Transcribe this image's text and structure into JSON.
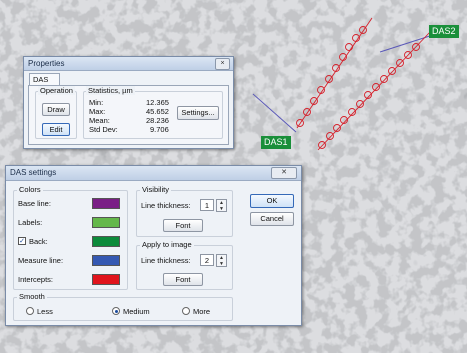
{
  "overlay_tags": [
    "DAS2",
    "DAS1"
  ],
  "properties": {
    "title": "Properties",
    "close_glyph": "×",
    "tab": "DAS",
    "operation": {
      "legend": "Operation",
      "draw": "Draw",
      "edit": "Edit"
    },
    "statistics": {
      "legend": "Statistics, µm",
      "rows": [
        {
          "label": "Min:",
          "value": "12.365"
        },
        {
          "label": "Max:",
          "value": "45.652"
        },
        {
          "label": "Mean:",
          "value": "28.236"
        },
        {
          "label": "Std Dev:",
          "value": "9.706"
        }
      ]
    },
    "settings_button": "Settings..."
  },
  "das_settings": {
    "title": "DAS settings",
    "close_glyph": "✕",
    "colors": {
      "legend": "Colors",
      "items": [
        {
          "label": "Base line:",
          "color": "#7a1f86"
        },
        {
          "label": "Labels:",
          "color": "#64b84a"
        },
        {
          "label": "Back:",
          "color": "#0c8a3a",
          "checked": true,
          "check_glyph": "✓"
        },
        {
          "label": "Measure line:",
          "color": "#3458b2"
        },
        {
          "label": "Intercepts:",
          "color": "#e0141c"
        }
      ]
    },
    "visibility": {
      "legend": "Visibility",
      "thickness_label": "Line thickness:",
      "thickness": "1",
      "font_button": "Font"
    },
    "apply": {
      "legend": "Apply to image",
      "thickness_label": "Line thickness:",
      "thickness": "2",
      "font_button": "Font"
    },
    "ok_button": "OK",
    "cancel_button": "Cancel",
    "smooth": {
      "legend": "Smooth",
      "options": [
        "Less",
        "Medium",
        "More"
      ],
      "selected": "Medium"
    }
  }
}
